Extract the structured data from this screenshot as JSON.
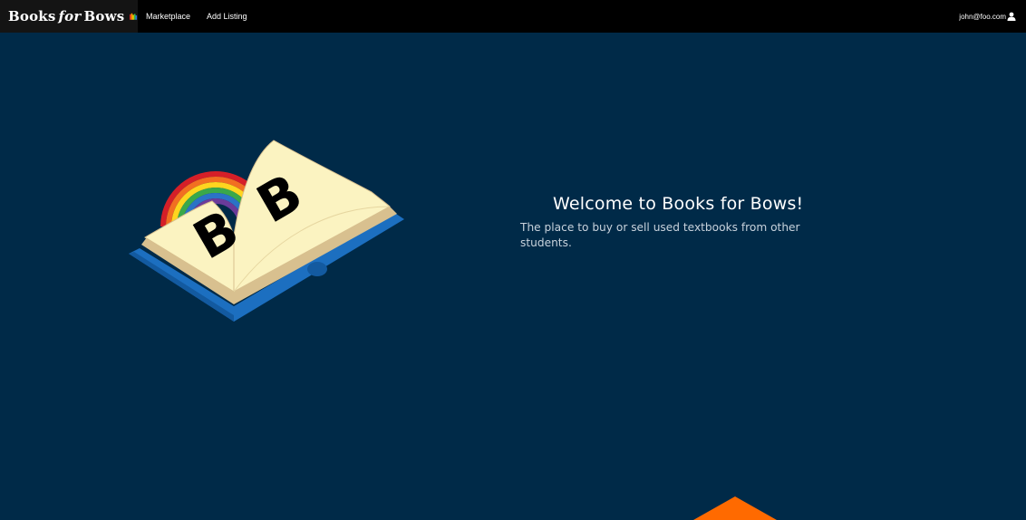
{
  "navbar": {
    "brand": {
      "word1": "Books",
      "word2": "for",
      "word3": "Bows",
      "icon": "books-icon"
    },
    "links": [
      {
        "label": "Marketplace"
      },
      {
        "label": "Add Listing"
      }
    ],
    "user": {
      "email": "john@foo.com",
      "icon": "user-icon"
    }
  },
  "hero": {
    "title": "Welcome to Books for Bows!",
    "subtitle": "The place to buy or sell used textbooks from other students.",
    "illustration": "open-book-rainbow-icon"
  },
  "colors": {
    "background": "#002a48",
    "navbar": "#000000",
    "accent": "#ff6a00"
  }
}
